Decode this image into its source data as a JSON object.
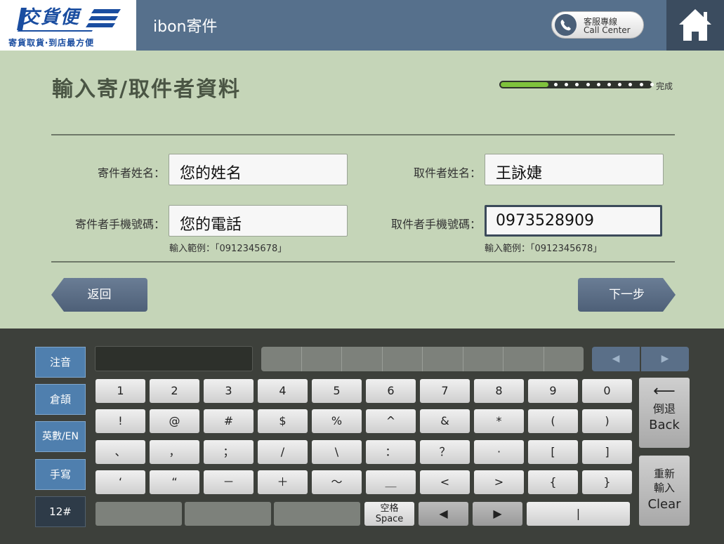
{
  "header": {
    "logo_text": "交貨便",
    "logo_slogan": "寄貨取貨‧到店最方便",
    "app_title": "ibon寄件",
    "call_center_label_zh": "客服專線",
    "call_center_label_en": "Call Center",
    "colors": {
      "bar": "#56708c",
      "home": "#3b4c5f",
      "logo": "#1a4da0"
    }
  },
  "form": {
    "title": "輸入寄/取件者資料",
    "progress": {
      "fraction": 0.32,
      "label": "完成",
      "fill_color": "#7fc23c"
    },
    "sender_name": {
      "label": "寄件者姓名：",
      "value": "您的姓名"
    },
    "sender_phone": {
      "label": "寄件者手機號碼：",
      "value": "您的電話",
      "hint": "輸入範例：「0912345678」"
    },
    "receiver_name": {
      "label": "取件者姓名：",
      "value": "王詠婕"
    },
    "receiver_phone": {
      "label": "取件者手機號碼：",
      "value": "0973528909",
      "hint": "輸入範例：「0912345678」"
    },
    "back_label": "返回",
    "next_label": "下一步",
    "colors": {
      "panel": "#c5d5b8",
      "nav": "#56708c"
    }
  },
  "keyboard": {
    "modes": [
      {
        "label": "注音",
        "active": false
      },
      {
        "label": "倉頡",
        "active": false
      },
      {
        "label": "英數/EN",
        "active": false
      },
      {
        "label": "手寫",
        "active": false
      },
      {
        "label": "12#",
        "active": true
      }
    ],
    "page_prev": "◀",
    "page_next": "▶",
    "row1": [
      "1",
      "2",
      "3",
      "4",
      "5",
      "6",
      "7",
      "8",
      "9",
      "0"
    ],
    "row2": [
      "!",
      "@",
      "#",
      "$",
      "%",
      "^",
      "&",
      "*",
      "(",
      ")"
    ],
    "row3": [
      "、",
      "，",
      "；",
      "/",
      "\\",
      "：",
      "？",
      "·",
      "[",
      "]"
    ],
    "row4": [
      "‘",
      "“",
      "－",
      "＋",
      "～",
      "＿",
      "<",
      ">",
      "{",
      "}"
    ],
    "space_zh": "空格",
    "space_en": "Space",
    "arrow_left": "◀",
    "arrow_right": "▶",
    "bar_key": "|",
    "backspace": {
      "arrow": "⟵",
      "zh": "倒退",
      "en": "Back"
    },
    "clear": {
      "zh_1": "重新",
      "zh_2": "輸入",
      "en": "Clear"
    }
  }
}
